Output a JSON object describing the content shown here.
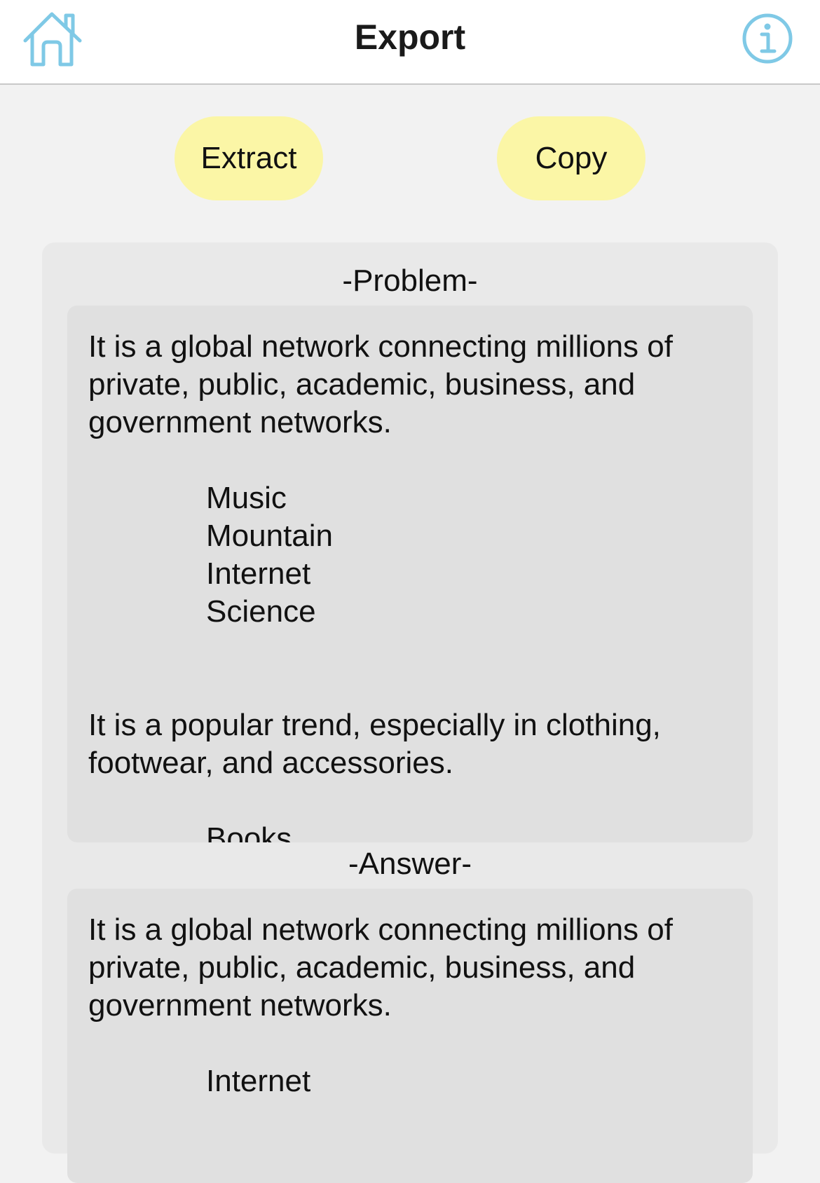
{
  "nav": {
    "title": "Export",
    "home_icon": "home-icon",
    "info_icon": "info-icon",
    "icon_color": "#7fc9e6"
  },
  "actions": {
    "extract_label": "Extract",
    "copy_label": "Copy",
    "button_color": "#fbf6a6"
  },
  "problem": {
    "label": "-Problem-",
    "q1_text": "It is a global network connecting millions of private, public, academic, business, and government networks.",
    "q1_options": [
      "Music",
      "Mountain",
      "Internet",
      "Science"
    ],
    "q2_text": "It is a popular trend, especially in clothing, footwear, and accessories.",
    "q2_first_option": "Books"
  },
  "answer": {
    "label": "-Answer-",
    "a1_text": "It is a global network connecting millions of private, public, academic, business, and government networks.",
    "a1_option": "Internet"
  }
}
